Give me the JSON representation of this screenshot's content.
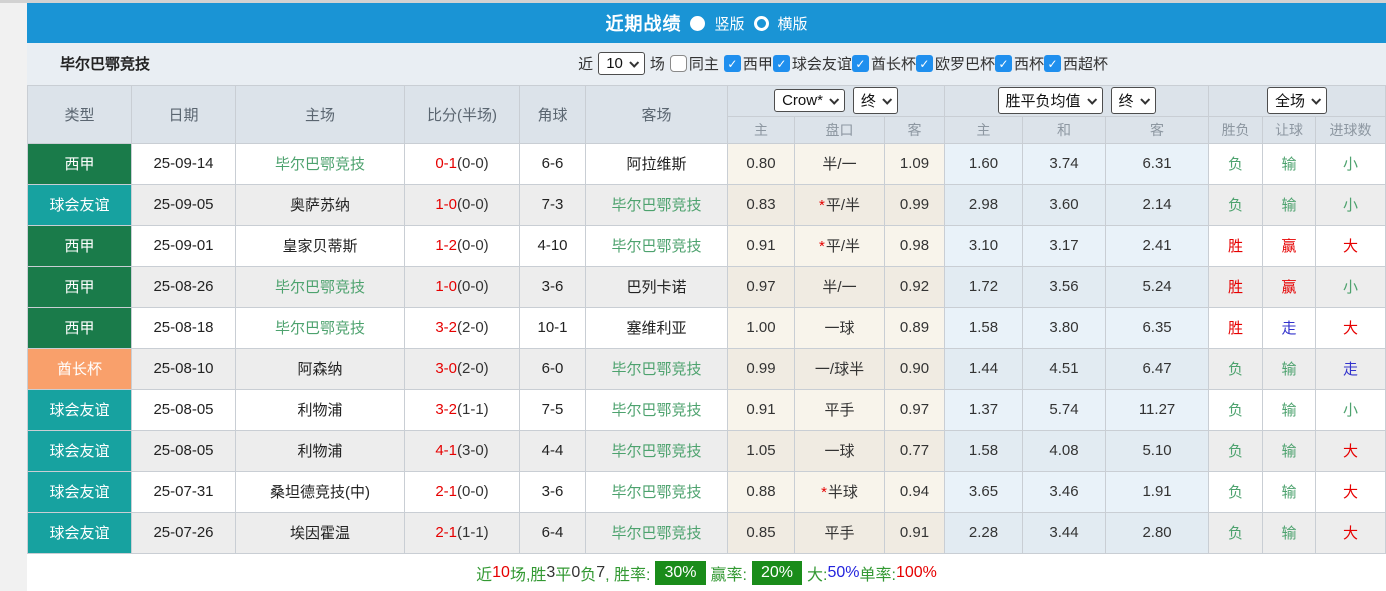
{
  "header": {
    "title": "近期战绩",
    "radio_vertical": "竖版",
    "radio_horizontal": "横版"
  },
  "filter": {
    "team": "毕尔巴鄂竞技",
    "near_label": "近",
    "near_value": "10",
    "games_label": "场",
    "same_venue_label": "同主",
    "leagues": [
      "西甲",
      "球会友谊",
      "酋长杯",
      "欧罗巴杯",
      "西杯",
      "西超杯"
    ]
  },
  "table": {
    "static_headers": [
      "类型",
      "日期",
      "主场",
      "比分(半场)",
      "角球",
      "客场"
    ],
    "dropdowns": {
      "odds_source": "Crow*",
      "odds_time": "终",
      "avg_label": "胜平负均值",
      "avg_time": "终",
      "scope": "全场"
    },
    "sub_headers": [
      "主",
      "盘口",
      "客",
      "主",
      "和",
      "客",
      "胜负",
      "让球",
      "进球数"
    ],
    "rows": [
      {
        "type": "西甲",
        "date": "25-09-14",
        "home": "毕尔巴鄂竞技",
        "home_self": true,
        "score": "0-1",
        "half": "(0-0)",
        "corners": "6-6",
        "away": "阿拉维斯",
        "away_self": false,
        "odds_home": "0.80",
        "handicap": "半/一",
        "handicap_star": false,
        "odds_away": "1.09",
        "avg_home": "1.60",
        "avg_draw": "3.74",
        "avg_away": "6.31",
        "result_wdl": "负",
        "result_handicap": "输",
        "result_goals": "小"
      },
      {
        "type": "球会友谊",
        "date": "25-09-05",
        "home": "奥萨苏纳",
        "home_self": false,
        "score": "1-0",
        "half": "(0-0)",
        "corners": "7-3",
        "away": "毕尔巴鄂竞技",
        "away_self": true,
        "odds_home": "0.83",
        "handicap": "平/半",
        "handicap_star": true,
        "odds_away": "0.99",
        "avg_home": "2.98",
        "avg_draw": "3.60",
        "avg_away": "2.14",
        "result_wdl": "负",
        "result_handicap": "输",
        "result_goals": "小"
      },
      {
        "type": "西甲",
        "date": "25-09-01",
        "home": "皇家贝蒂斯",
        "home_self": false,
        "score": "1-2",
        "half": "(0-0)",
        "corners": "4-10",
        "away": "毕尔巴鄂竞技",
        "away_self": true,
        "odds_home": "0.91",
        "handicap": "平/半",
        "handicap_star": true,
        "odds_away": "0.98",
        "avg_home": "3.10",
        "avg_draw": "3.17",
        "avg_away": "2.41",
        "result_wdl": "胜",
        "result_handicap": "赢",
        "result_goals": "大"
      },
      {
        "type": "西甲",
        "date": "25-08-26",
        "home": "毕尔巴鄂竞技",
        "home_self": true,
        "score": "1-0",
        "half": "(0-0)",
        "corners": "3-6",
        "away": "巴列卡诺",
        "away_self": false,
        "odds_home": "0.97",
        "handicap": "半/一",
        "handicap_star": false,
        "odds_away": "0.92",
        "avg_home": "1.72",
        "avg_draw": "3.56",
        "avg_away": "5.24",
        "result_wdl": "胜",
        "result_handicap": "赢",
        "result_goals": "小"
      },
      {
        "type": "西甲",
        "date": "25-08-18",
        "home": "毕尔巴鄂竞技",
        "home_self": true,
        "score": "3-2",
        "half": "(2-0)",
        "corners": "10-1",
        "away": "塞维利亚",
        "away_self": false,
        "odds_home": "1.00",
        "handicap": "一球",
        "handicap_star": false,
        "odds_away": "0.89",
        "avg_home": "1.58",
        "avg_draw": "3.80",
        "avg_away": "6.35",
        "result_wdl": "胜",
        "result_handicap": "走",
        "result_goals": "大"
      },
      {
        "type": "酋长杯",
        "date": "25-08-10",
        "home": "阿森纳",
        "home_self": false,
        "score": "3-0",
        "half": "(2-0)",
        "corners": "6-0",
        "away": "毕尔巴鄂竞技",
        "away_self": true,
        "odds_home": "0.99",
        "handicap": "一/球半",
        "handicap_star": false,
        "odds_away": "0.90",
        "avg_home": "1.44",
        "avg_draw": "4.51",
        "avg_away": "6.47",
        "result_wdl": "负",
        "result_handicap": "输",
        "result_goals": "走"
      },
      {
        "type": "球会友谊",
        "date": "25-08-05",
        "home": "利物浦",
        "home_self": false,
        "score": "3-2",
        "half": "(1-1)",
        "corners": "7-5",
        "away": "毕尔巴鄂竞技",
        "away_self": true,
        "odds_home": "0.91",
        "handicap": "平手",
        "handicap_star": false,
        "odds_away": "0.97",
        "avg_home": "1.37",
        "avg_draw": "5.74",
        "avg_away": "11.27",
        "result_wdl": "负",
        "result_handicap": "输",
        "result_goals": "小"
      },
      {
        "type": "球会友谊",
        "date": "25-08-05",
        "home": "利物浦",
        "home_self": false,
        "score": "4-1",
        "half": "(3-0)",
        "corners": "4-4",
        "away": "毕尔巴鄂竞技",
        "away_self": true,
        "odds_home": "1.05",
        "handicap": "一球",
        "handicap_star": false,
        "odds_away": "0.77",
        "avg_home": "1.58",
        "avg_draw": "4.08",
        "avg_away": "5.10",
        "result_wdl": "负",
        "result_handicap": "输",
        "result_goals": "大"
      },
      {
        "type": "球会友谊",
        "date": "25-07-31",
        "home": "桑坦德竞技(中)",
        "home_self": false,
        "score": "2-1",
        "half": "(0-0)",
        "corners": "3-6",
        "away": "毕尔巴鄂竞技",
        "away_self": true,
        "odds_home": "0.88",
        "handicap": "半球",
        "handicap_star": true,
        "odds_away": "0.94",
        "avg_home": "3.65",
        "avg_draw": "3.46",
        "avg_away": "1.91",
        "result_wdl": "负",
        "result_handicap": "输",
        "result_goals": "大"
      },
      {
        "type": "球会友谊",
        "date": "25-07-26",
        "home": "埃因霍温",
        "home_self": false,
        "score": "2-1",
        "half": "(1-1)",
        "corners": "6-4",
        "away": "毕尔巴鄂竞技",
        "away_self": true,
        "odds_home": "0.85",
        "handicap": "平手",
        "handicap_star": false,
        "odds_away": "0.91",
        "avg_home": "2.28",
        "avg_draw": "3.44",
        "avg_away": "2.80",
        "result_wdl": "负",
        "result_handicap": "输",
        "result_goals": "大"
      }
    ]
  },
  "colors": {
    "accent_blue": "#1a94d5",
    "type_colors": {
      "西甲": "#1a7b4a",
      "球会友谊": "#17a2a0",
      "酋长杯": "#f9a06b"
    },
    "result_colors": {
      "胜": "#e60000",
      "赢": "#e60000",
      "大": "#e60000",
      "负": "#4da26e",
      "输": "#4da26e",
      "小": "#4da26e",
      "走": "#3333cc"
    },
    "team_highlight": "#4da26e",
    "score_red": "#e60000",
    "summary_badge_green": "#1a8c1a",
    "summary_colors": {
      "green": "#339933",
      "red": "#e60000",
      "dark": "#333333",
      "blue": "#2323dd"
    }
  },
  "summary": {
    "segments": [
      {
        "text": "近",
        "color": "green"
      },
      {
        "text": "10",
        "color": "red"
      },
      {
        "text": "场,胜",
        "color": "green"
      },
      {
        "text": "3",
        "color": "dark"
      },
      {
        "text": "平",
        "color": "green"
      },
      {
        "text": "0",
        "color": "dark"
      },
      {
        "text": "负",
        "color": "green"
      },
      {
        "text": "7",
        "color": "dark"
      },
      {
        "text": ", 胜率:",
        "color": "green"
      },
      {
        "text": "30%",
        "badge": true
      },
      {
        "text": " 赢率:",
        "color": "green"
      },
      {
        "text": "20%",
        "badge": true
      },
      {
        "text": " 大:",
        "color": "green"
      },
      {
        "text": "50%",
        "color": "blue"
      },
      {
        "text": " 单率:",
        "color": "green"
      },
      {
        "text": "100%",
        "color": "red"
      }
    ]
  }
}
